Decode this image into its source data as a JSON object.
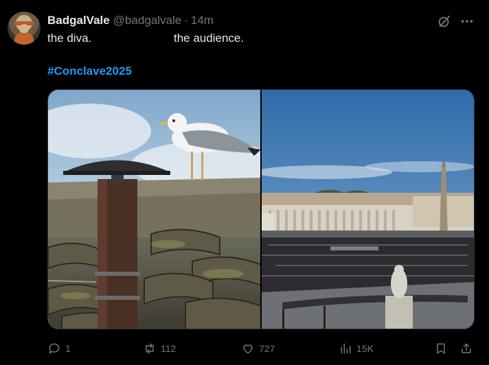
{
  "author": {
    "display_name": "BadgalVale",
    "handle": "@badgalvale",
    "separator": "·",
    "time": "14m"
  },
  "post": {
    "text_left": "the diva.",
    "text_right": "the audience.",
    "hashtag": "#Conclave2025"
  },
  "actions": {
    "replies": "1",
    "reposts": "112",
    "likes": "727",
    "views": "15K"
  },
  "icons": {
    "grok": "grok-icon",
    "more": "more-icon",
    "reply": "reply-icon",
    "repost": "repost-icon",
    "like": "heart-icon",
    "views": "views-icon",
    "bookmark": "bookmark-icon",
    "share": "share-icon"
  },
  "colors": {
    "background": "#000000",
    "text": "#e7e9ea",
    "muted": "#71767b",
    "link": "#1d9bf0"
  }
}
